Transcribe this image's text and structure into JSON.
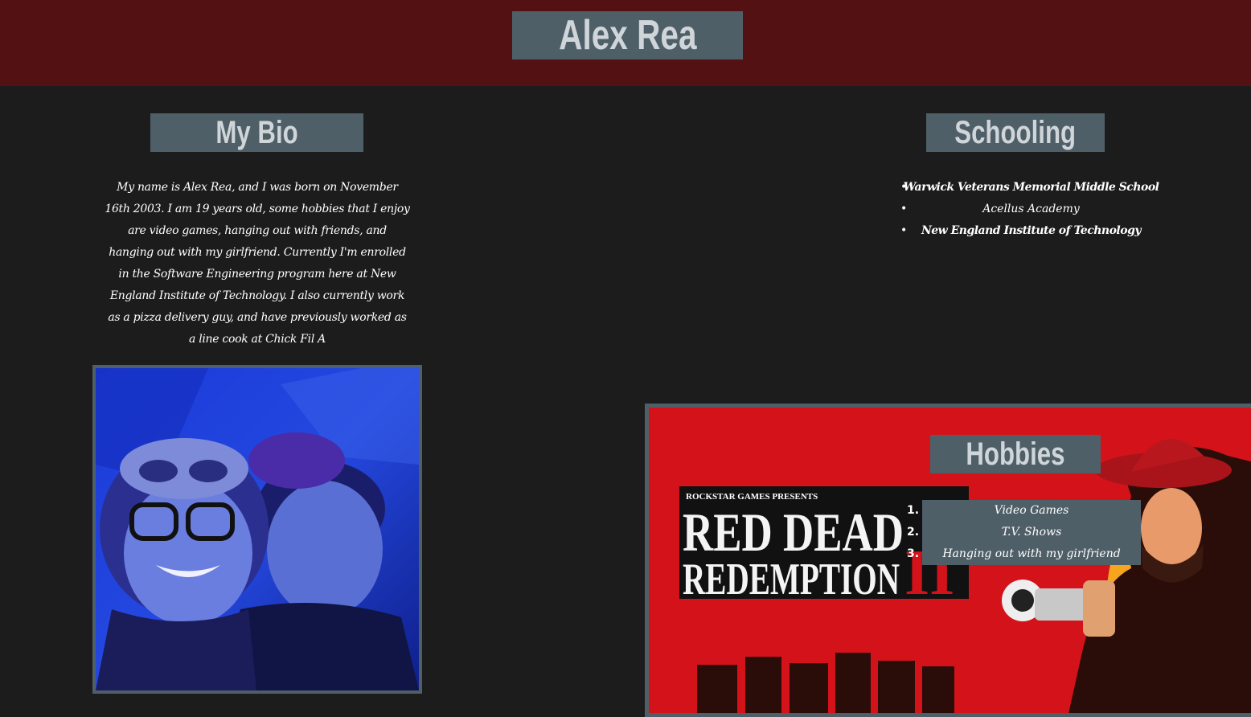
{
  "header": {
    "title": "Alex Rea"
  },
  "bio": {
    "heading": "My Bio",
    "text_1": "My name is ",
    "name": "Alex Rea",
    "text_2": ", and I was born on November 16th 2003. I am 19 years old, some hobbies that I enjoy are video games, hanging out with friends, and hanging out with my girlfriend. Currently I'm enrolled in the Software Engineering program here at New England Institute of Technology. I also currently work as a pizza delivery guy, and have previously worked as a line cook at ",
    "employer": "Chick Fil A",
    "photo_icon": "couple-photo-icon"
  },
  "schooling": {
    "heading": "Schooling",
    "items": [
      "Warwick Veterans Memorial Middle School",
      "Acellus Academy",
      "New England Institute of Technology"
    ]
  },
  "hobbies": {
    "heading": "Hobbies",
    "poster_publisher": "ROCKSTAR GAMES PRESENTS",
    "poster_line1": "RED DEAD",
    "poster_line2": "REDEMPTION",
    "poster_numeral": "II",
    "items": [
      "Video Games",
      "T.V. Shows",
      "Hanging out with my girlfriend"
    ],
    "numbers": [
      "1.",
      "2.",
      "3."
    ]
  },
  "colors": {
    "header_bg": "#531114",
    "page_bg": "#1c1c1c",
    "title_box": "#4f5f68",
    "poster_red": "#d4121a"
  }
}
